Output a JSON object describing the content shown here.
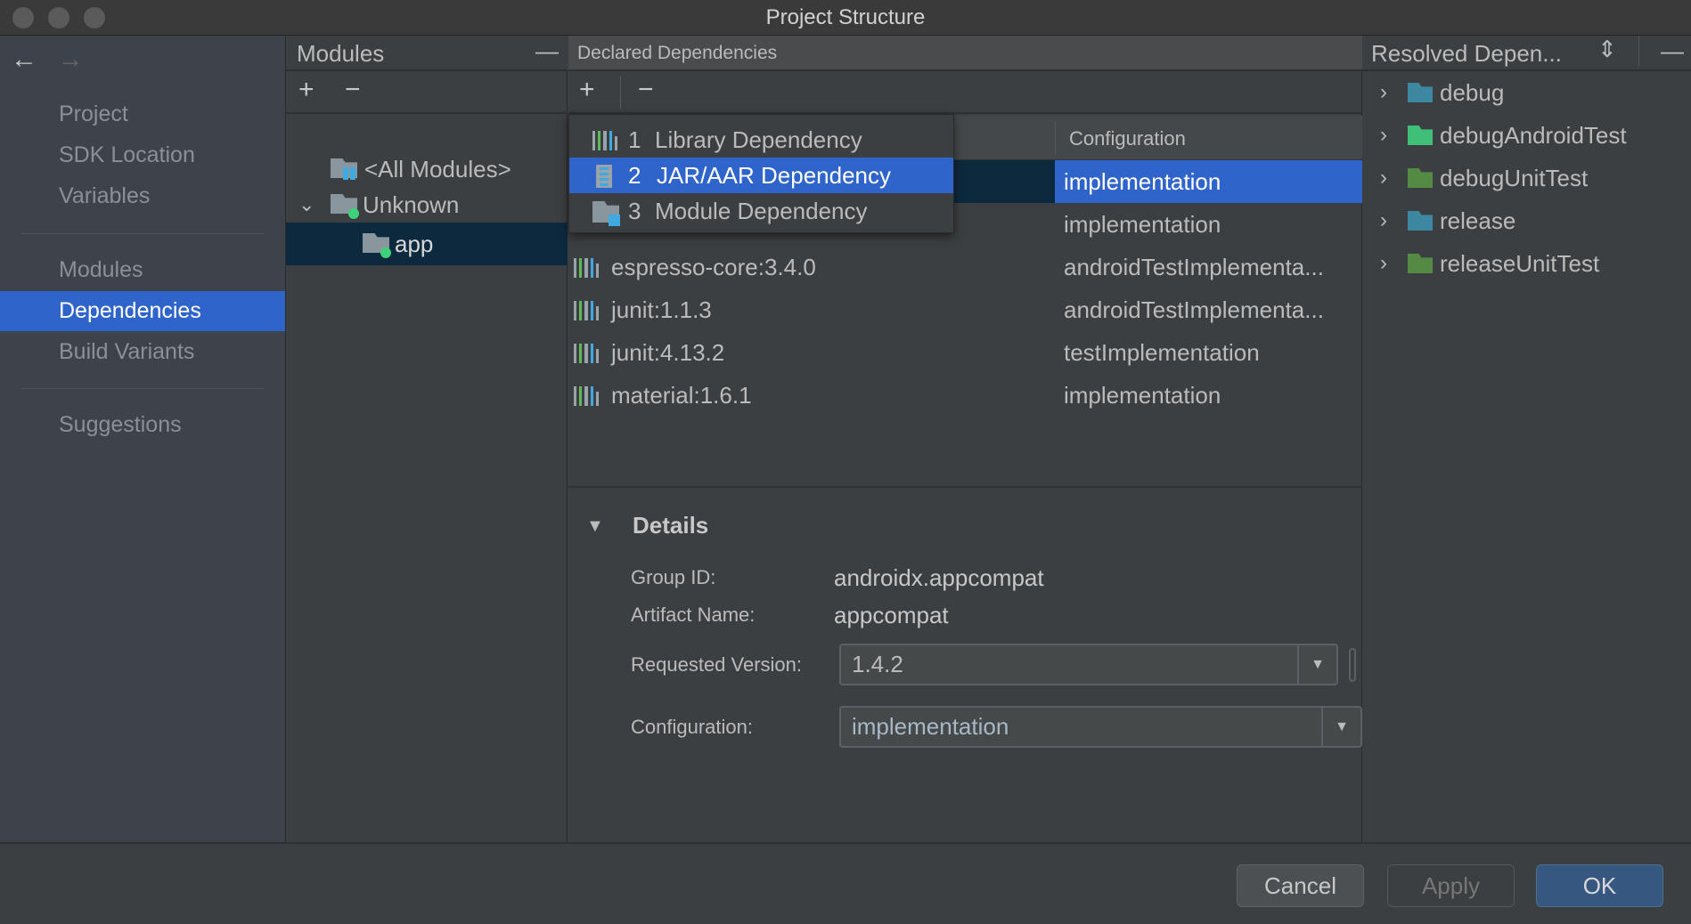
{
  "window": {
    "title": "Project Structure"
  },
  "sidebar": {
    "back_icon": "arrow-left",
    "forward_icon": "arrow-right",
    "groups": [
      [
        "Project",
        "SDK Location",
        "Variables"
      ],
      [
        "Modules",
        "Dependencies",
        "Build Variants"
      ],
      [
        "Suggestions"
      ]
    ],
    "items": {
      "project": "Project",
      "sdk": "SDK Location",
      "variables": "Variables",
      "modules": "Modules",
      "dependencies": "Dependencies",
      "build_variants": "Build Variants",
      "suggestions": "Suggestions"
    },
    "selected": "Dependencies",
    "accent": "#2f65ca"
  },
  "modules_panel": {
    "title": "Modules",
    "add": "+",
    "remove": "−",
    "minimize": "—",
    "tree": {
      "all": "<All Modules>",
      "unknown": "Unknown",
      "app": "app"
    }
  },
  "declared_panel": {
    "title": "Declared Dependencies",
    "add": "+",
    "remove": "−",
    "columns": {
      "configuration": "Configuration"
    },
    "rows": [
      {
        "name": "",
        "configuration": "implementation",
        "selected": true
      },
      {
        "name": "",
        "configuration": "implementation"
      },
      {
        "name": "espresso-core:3.4.0",
        "configuration": "androidTestImplementa..."
      },
      {
        "name": "junit:1.1.3",
        "configuration": "androidTestImplementa..."
      },
      {
        "name": "junit:4.13.2",
        "configuration": "testImplementation"
      },
      {
        "name": "material:1.6.1",
        "configuration": "implementation"
      }
    ],
    "popup": [
      {
        "num": "1",
        "label": "Library Dependency",
        "icon": "library-icon"
      },
      {
        "num": "2",
        "label": "JAR/AAR Dependency",
        "icon": "jar-icon",
        "selected": true
      },
      {
        "num": "3",
        "label": "Module Dependency",
        "icon": "module-icon"
      }
    ],
    "details": {
      "title": "Details",
      "group_id_label": "Group ID:",
      "group_id": "androidx.appcompat",
      "artifact_label": "Artifact Name:",
      "artifact": "appcompat",
      "version_label": "Requested Version:",
      "version": "1.4.2",
      "config_label": "Configuration:",
      "config": "implementation"
    }
  },
  "resolved_panel": {
    "title": "Resolved Depen...",
    "minimize": "—",
    "items": [
      {
        "label": "debug",
        "color": "#3d87a0"
      },
      {
        "label": "debugAndroidTest",
        "color": "#3fbf78"
      },
      {
        "label": "debugUnitTest",
        "color": "#548a44"
      },
      {
        "label": "release",
        "color": "#3d87a0"
      },
      {
        "label": "releaseUnitTest",
        "color": "#548a44"
      }
    ]
  },
  "footer": {
    "cancel": "Cancel",
    "apply": "Apply",
    "ok": "OK"
  }
}
